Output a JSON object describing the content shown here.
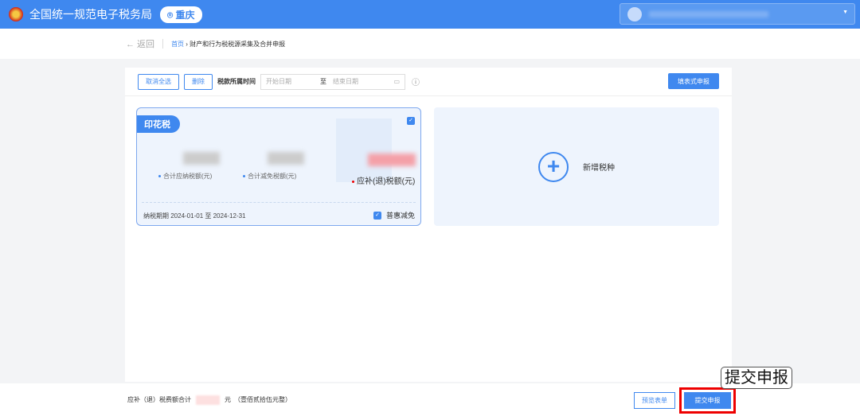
{
  "header": {
    "title": "全国统一规范电子税务局",
    "region": "重庆"
  },
  "nav": {
    "back": "← 返回",
    "home": "首页",
    "current": "财产和行为税税源采集及合并申报"
  },
  "toolbar": {
    "deselect_all": "取消全选",
    "delete": "删除",
    "period_label": "税款所属时间",
    "start_placeholder": "开始日期",
    "to": "至",
    "end_placeholder": "结束日期",
    "fill_form": "填表式申报"
  },
  "card": {
    "tax_name": "印花税",
    "label_payable": "合计应纳税额(元)",
    "label_relief": "合计减免税额(元)",
    "label_due": "应补(退)税额(元)",
    "period": "纳税期期 2024-01-01 至 2024-12-31",
    "relief_option": "普惠减免"
  },
  "add": {
    "label": "新增税种"
  },
  "footer": {
    "total_label": "应补（退）税费额合计",
    "unit": "元",
    "amount_words": "（壹佰贰拾伍元整）",
    "preview": "预览表单",
    "submit": "提交申报"
  },
  "callout": "提交申报",
  "colors": {
    "primary": "#3f88ef",
    "highlight": "#e00000"
  }
}
